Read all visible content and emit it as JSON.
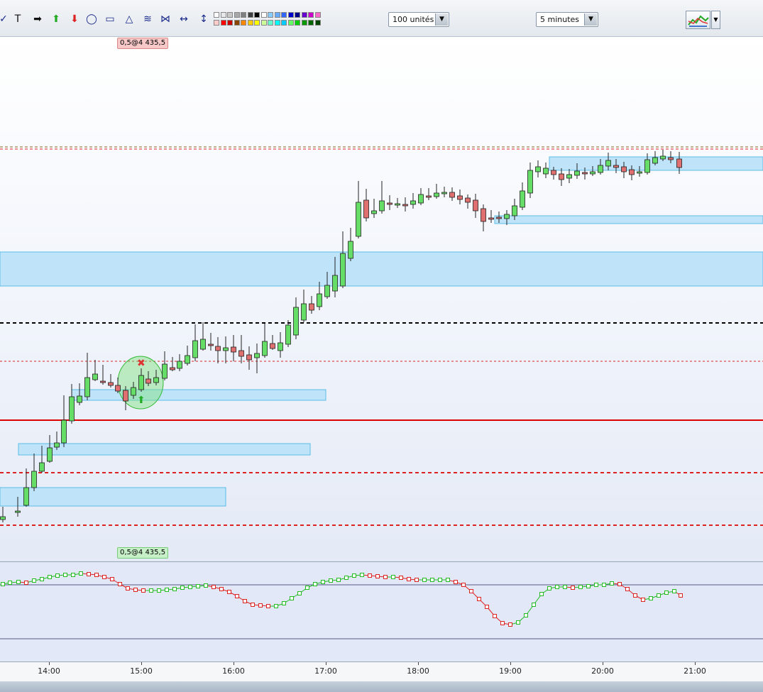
{
  "toolbar": {
    "tools": [
      {
        "icon": "pencil-icon",
        "glyph": "✓"
      },
      {
        "icon": "text-tool-icon",
        "glyph": "T"
      },
      {
        "icon": "arrow-right-icon",
        "glyph": "➡"
      },
      {
        "icon": "arrow-up-icon",
        "glyph": "⬆"
      },
      {
        "icon": "arrow-down-icon",
        "glyph": "⬇"
      },
      {
        "icon": "ellipse-tool-icon",
        "glyph": "◯"
      },
      {
        "icon": "rectangle-tool-icon",
        "glyph": "▭"
      },
      {
        "icon": "triangle-tool-icon",
        "glyph": "△"
      },
      {
        "icon": "fibonacci-retracement-icon",
        "glyph": "≋"
      },
      {
        "icon": "fibonacci-fan-icon",
        "glyph": "⋈"
      },
      {
        "icon": "horizontal-measure-icon",
        "glyph": "↔"
      },
      {
        "icon": "vertical-measure-icon",
        "glyph": "↕"
      }
    ],
    "palette_top": [
      "#ffffff",
      "#e8e8e8",
      "#c8c8c8",
      "#a8a8a8",
      "#808080",
      "#404040",
      "#000000",
      "#ffffff",
      "#88ccff",
      "#66aaff",
      "#3366ff",
      "#0000cc",
      "#000088",
      "#6600cc",
      "#cc00cc",
      "#ff66cc"
    ],
    "palette_bottom": [
      "#ffcccc",
      "#ff0000",
      "#cc0000",
      "#884400",
      "#ff8800",
      "#ffcc00",
      "#ffff00",
      "#ccff99",
      "#66ffcc",
      "#00ffff",
      "#00ccff",
      "#66ff66",
      "#00cc00",
      "#009900",
      "#006600",
      "#004400"
    ],
    "quantity_value": "100 unités",
    "timeframe_value": "5 minutes",
    "chart_button_icon": "chart-settings-icon"
  },
  "orders": {
    "top_tag": "0,5@4 435,5",
    "bottom_tag": "0,5@4 435,5",
    "top_tag_color": "#f7c8c8",
    "bottom_tag_color": "#c8f0c8"
  },
  "colors": {
    "bull_candle": "#66dd66",
    "bear_candle": "#e07070",
    "zone_fill": "#bfe4fa",
    "zone_border": "#5bbde6",
    "support_line": "#dd0000",
    "osc_up": "#22bb22",
    "osc_down": "#dd2222"
  },
  "xaxis": {
    "labels": [
      "14:00",
      "15:00",
      "16:00",
      "17:00",
      "18:00",
      "19:00",
      "20:00",
      "21:00"
    ]
  }
}
